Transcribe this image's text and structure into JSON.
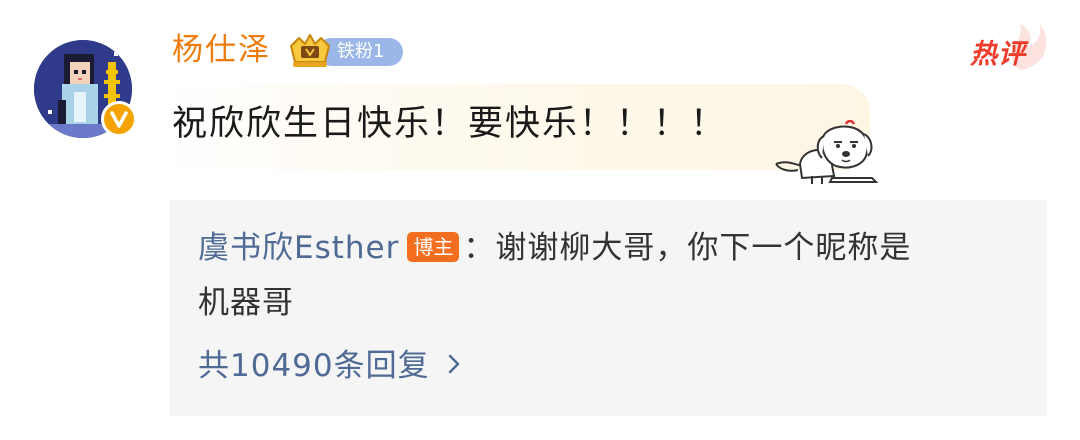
{
  "comment": {
    "username": "杨仕泽",
    "fan_badge": "铁粉1",
    "hot_badge": "热评",
    "text": "祝欣欣生日快乐！要快乐！！！！",
    "icons": {
      "avatar": "pixel-art-avatar",
      "verified": "verified-v-icon",
      "fan_crown": "crown-icon",
      "sticker": "dog-sticker",
      "chevron": "chevron-right-icon"
    }
  },
  "reply": {
    "author": "虞书欣Esther",
    "author_tag": "博主",
    "separator": "：",
    "text_line1": "谢谢柳大哥，你下一个昵称是",
    "text_line2": "机器哥",
    "count_label": "共10490条回复"
  },
  "colors": {
    "username": "#f07c0e",
    "link_blue": "#4f6a94",
    "hot_red": "#ef3b2c",
    "author_tag_bg": "#f36e1e",
    "fan_badge_bg": "#9bb7e8",
    "reply_bg": "#f5f5f5"
  }
}
